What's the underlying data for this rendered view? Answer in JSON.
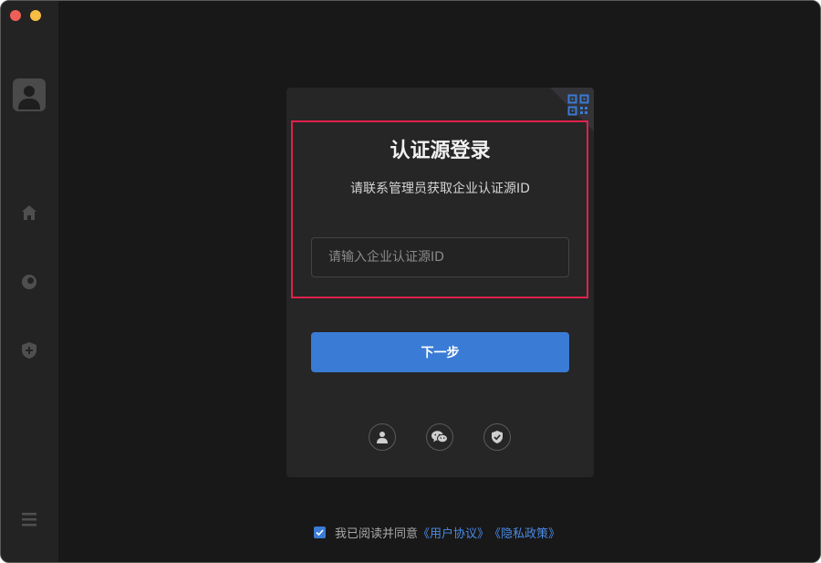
{
  "window": {
    "buttons": [
      "close",
      "minimize"
    ]
  },
  "sidebar": {
    "items": [
      {
        "name": "avatar",
        "icon": "user-icon"
      },
      {
        "name": "home",
        "icon": "home-icon"
      },
      {
        "name": "circle",
        "icon": "circle-icon"
      },
      {
        "name": "shield",
        "icon": "shield-plus-icon"
      },
      {
        "name": "menu",
        "icon": "hamburger-icon"
      }
    ]
  },
  "login": {
    "title": "认证源登录",
    "subtitle": "请联系管理员获取企业认证源ID",
    "input_placeholder": "请输入企业认证源ID",
    "input_value": "",
    "next_label": "下一步",
    "corner_icon": "qr-code-icon",
    "alt_methods": [
      {
        "name": "account",
        "icon": "user-icon"
      },
      {
        "name": "wechat",
        "icon": "wechat-icon"
      },
      {
        "name": "security",
        "icon": "shield-check-icon"
      }
    ]
  },
  "agreement": {
    "checked": true,
    "text": "我已阅读并同意",
    "user_agreement": "《用户协议》",
    "privacy_policy": "《隐私政策》"
  },
  "colors": {
    "accent": "#3a7bd5",
    "link": "#4a8ae6",
    "highlight": "#e0214b",
    "background": "#181818",
    "card": "#262626"
  }
}
